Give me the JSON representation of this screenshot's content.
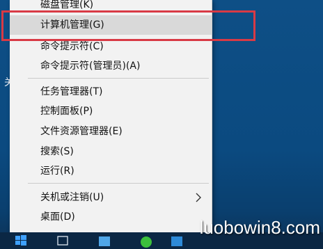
{
  "desktop": {
    "edge_label": "关"
  },
  "menu": {
    "items": [
      {
        "label": "磁盘管理(K)"
      },
      {
        "label": "计算机管理(G)"
      },
      {
        "label": "命令提示符(C)"
      },
      {
        "label": "命令提示符(管理员)(A)"
      },
      {
        "label": "任务管理器(T)"
      },
      {
        "label": "控制面板(P)"
      },
      {
        "label": "文件资源管理器(E)"
      },
      {
        "label": "搜索(S)"
      },
      {
        "label": "运行(R)"
      },
      {
        "label": "关机或注销(U)"
      },
      {
        "label": "桌面(D)"
      }
    ]
  },
  "watermark": "luobowin8.com",
  "colors": {
    "highlight_box": "#d93a45",
    "menu_bg": "#f2f2f2",
    "desktop": "#0e4f86"
  }
}
